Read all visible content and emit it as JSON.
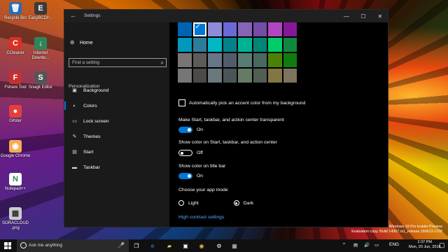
{
  "desktop": {
    "icons": [
      {
        "label": "Recycle Bin",
        "glyph": "🗑",
        "bg": "#2b6cb0"
      },
      {
        "label": "EasyBCDP...",
        "glyph": "E",
        "bg": "#3a3a3a"
      },
      {
        "label": "CCleaner",
        "glyph": "C",
        "bg": "#d93025"
      },
      {
        "label": "Internet Downlo...",
        "glyph": "↓",
        "bg": "#2f855a"
      },
      {
        "label": "Fshare Tool",
        "glyph": "F",
        "bg": "#c53030"
      },
      {
        "label": "Snagit Editor",
        "glyph": "S",
        "bg": "#555555"
      },
      {
        "label": "Gifster",
        "glyph": "●",
        "bg": "#e53e3e"
      },
      {
        "label": "Google Chrome",
        "glyph": "◉",
        "bg": "#f6ad55"
      },
      {
        "label": "Notepad++",
        "glyph": "N",
        "bg": "#ffffff"
      },
      {
        "label": "SORACLOUD .png",
        "glyph": "▦",
        "bg": "#cccccc"
      }
    ],
    "watermark": {
      "line1": "Windows 10 Pro Insider Preview",
      "line2": "Evaluation copy. Build 14367.rs1_release.160613-1700"
    }
  },
  "window": {
    "title": "Settings",
    "back_glyph": "←",
    "controls": {
      "minimize": "—",
      "maximize": "☐",
      "close": "✕"
    }
  },
  "nav": {
    "home": "Home",
    "search_placeholder": "Find a setting",
    "section": "Personalization",
    "items": [
      {
        "label": "Background",
        "icon": "picture-icon",
        "glyph": "▣"
      },
      {
        "label": "Colors",
        "icon": "palette-icon",
        "glyph": "◐"
      },
      {
        "label": "Lock screen",
        "icon": "monitor-icon",
        "glyph": "▭"
      },
      {
        "label": "Themes",
        "icon": "brush-icon",
        "glyph": "✎"
      },
      {
        "label": "Start",
        "icon": "start-icon",
        "glyph": "▤"
      },
      {
        "label": "Taskbar",
        "icon": "taskbar-icon",
        "glyph": "▬"
      }
    ],
    "active": "Colors"
  },
  "colors": {
    "swatches": [
      "#0063b1",
      "#0078d7",
      "#8e8cd8",
      "#6b69d6",
      "#8764b8",
      "#744da9",
      "#b146c2",
      "#881798",
      "#0099bc",
      "#2d7d9a",
      "#00b7c3",
      "#038387",
      "#00b294",
      "#018574",
      "#00cc6a",
      "#10893e",
      "#7a7574",
      "#5d5a58",
      "#68768a",
      "#515c6b",
      "#567c73",
      "#486860",
      "#498205",
      "#107c10",
      "#767676",
      "#4c4a48",
      "#69797e",
      "#4a5459",
      "#647c64",
      "#525e54",
      "#847545",
      "#7e735f"
    ],
    "selected_index": 1,
    "auto_pick_label": "Automatically pick an accent color from my background",
    "auto_pick_checked": false,
    "transparent_label": "Make Start, taskbar, and action center transparent",
    "transparent_state": "On",
    "show_color_start_label": "Show color on Start, taskbar, and action center",
    "show_color_start_state": "Off",
    "title_bar_label": "Show color on title bar",
    "title_bar_state": "On",
    "app_mode_label": "Choose your app mode",
    "mode_light": "Light",
    "mode_dark": "Dark",
    "mode_selected": "Dark",
    "high_contrast_link": "High contrast settings"
  },
  "taskbar": {
    "search_placeholder": "Ask me anything",
    "apps": [
      {
        "name": "task-view-icon",
        "glyph": "❐",
        "color": "#ffffff"
      },
      {
        "name": "edge-icon",
        "glyph": "e",
        "color": "#3b8fe6"
      },
      {
        "name": "file-explorer-icon",
        "glyph": "▰",
        "color": "#f2c94c"
      },
      {
        "name": "store-icon",
        "glyph": "▣",
        "color": "#ffffff"
      },
      {
        "name": "chrome-icon",
        "glyph": "◉",
        "color": "#f6ad55"
      },
      {
        "name": "settings-icon",
        "glyph": "⚙",
        "color": "#ffffff"
      },
      {
        "name": "app-icon",
        "glyph": "▦",
        "color": "#cccccc"
      }
    ],
    "language": "ENG",
    "time": "2:37 PM",
    "date": "Mon, 20 Jun, 2016"
  }
}
